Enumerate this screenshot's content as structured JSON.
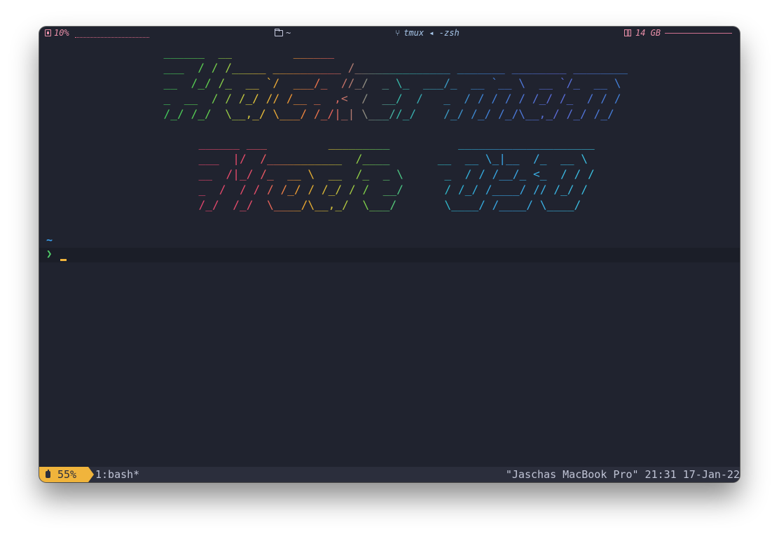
{
  "topbar": {
    "cpu_percent": "10%",
    "directory": "~",
    "session": "tmux ◂ -zsh",
    "memory": "14 GB"
  },
  "banner": {
    "line1": [
      "  ______  __         ______",
      "  ___  / / /_____ __________ /______________ _______ ________ ________",
      "  __  /_/ /_  __ `/  ___/_  //_/  _ \\_  ___/_  __ `__ \\  __ `/_  __ \\",
      "  _  __  / / /_/ // /__ _  ,<  /  __/  /   _  / / / / / /_/ /_  / / /",
      "  /_/ /_/  \\__,_/ \\___/ /_/|_| \\___//_/    /_/ /_/ /_/\\__,_/ /_/ /_/"
    ],
    "line2": [
      "  ______ ___         _________          ____________________",
      "  ___  |/  /___________  /____       __  __ \\_|__  /_  __ \\",
      "  __  /|_/ /_  __ \\  __  /_  _ \\      _  / / /__/_ <_  / / /",
      "  _  /  / / / /_/ / /_/ / /  __/      / /_/ /____/ // /_/ /",
      "  /_/  /_/  \\____/\\__,_/  \\___/       \\____/ /____/ \\____/"
    ]
  },
  "prompt": {
    "cwd": "~",
    "symbol": "❯"
  },
  "statusbar": {
    "battery": "55%",
    "window": "1:bash*",
    "right": "\"Jaschas MacBook Pro\" 21:31 17-Jan-22"
  },
  "colors": {
    "background": "#20232f",
    "status_bg": "#2b2e3c",
    "battery_accent": "#f0b43c",
    "prompt_green": "#52d06a",
    "cwd_blue": "#3aa0f0",
    "top_pink": "#e88ea8"
  }
}
